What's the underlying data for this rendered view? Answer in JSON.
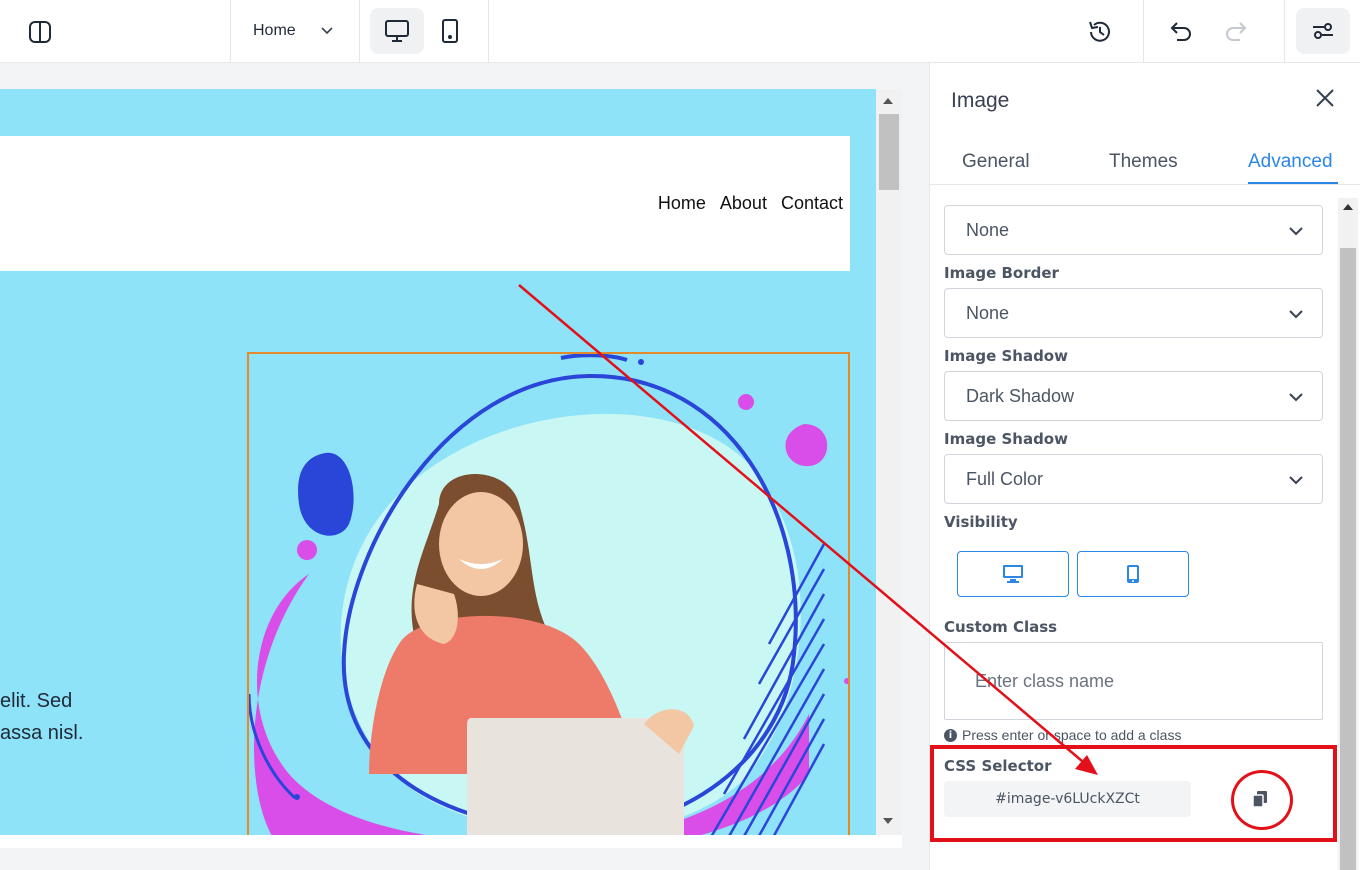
{
  "toolbar": {
    "page_select_value": "Home",
    "icons": [
      "sidebar-toggle-icon",
      "desktop-icon",
      "tablet-icon",
      "history-icon",
      "undo-icon",
      "redo-icon",
      "settings-sliders-icon"
    ]
  },
  "canvas": {
    "nav": [
      "Home",
      "About",
      "Contact"
    ],
    "hero_line1": "elit. Sed",
    "hero_line2": "assa nisl."
  },
  "panel": {
    "title": "Image",
    "tabs": [
      "General",
      "Themes",
      "Advanced"
    ],
    "active_tab": "Advanced",
    "fields": {
      "first_select": "None",
      "image_border_label": "Image Border",
      "image_border_value": "None",
      "image_shadow_label": "Image Shadow",
      "image_shadow_value": "Dark Shadow",
      "image_shadow2_label": "Image Shadow",
      "image_shadow2_value": "Full Color",
      "visibility_label": "Visibility",
      "custom_class_label": "Custom Class",
      "custom_class_placeholder": "Enter class name",
      "hint": "Press enter or space to add a class",
      "css_selector_label": "CSS Selector",
      "css_selector_value": "#image-v6LUckXZCt"
    }
  },
  "colors": {
    "accent": "#2b86e5",
    "annotation": "#e3101a",
    "canvas_bg": "#8ee3f8",
    "image_border": "#e58a2b"
  }
}
